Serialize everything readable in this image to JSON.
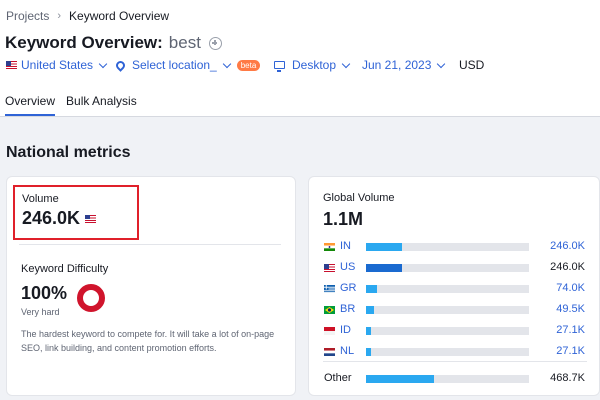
{
  "breadcrumb": {
    "root": "Projects",
    "current": "Keyword Overview"
  },
  "header": {
    "title": "Keyword Overview:",
    "keyword": "best"
  },
  "filters": {
    "country": "United States",
    "location": "Select location_",
    "location_badge": "beta",
    "device": "Desktop",
    "date": "Jun 21, 2023",
    "currency": "USD"
  },
  "tabs": [
    {
      "label": "Overview"
    },
    {
      "label": "Bulk Analysis"
    }
  ],
  "section_title": "National metrics",
  "volume": {
    "label": "Volume",
    "value": "246.0K"
  },
  "keyword_difficulty": {
    "label": "Keyword Difficulty",
    "value": "100%",
    "level": "Very hard",
    "percent": 100,
    "description": "The hardest keyword to compete for. It will take a lot of on-page SEO, link building, and content promotion efforts."
  },
  "global_volume": {
    "label": "Global Volume",
    "value": "1.1M",
    "rows": [
      {
        "code": "IN",
        "value": "246.0K",
        "share": 0.22,
        "color": "#2aa8f0",
        "icon": "india-flag-icon"
      },
      {
        "code": "US",
        "value": "246.0K",
        "share": 0.22,
        "color": "#1a6ad0",
        "icon": "usa-flag-icon"
      },
      {
        "code": "GR",
        "value": "74.0K",
        "share": 0.07,
        "color": "#2aa8f0",
        "icon": "greece-flag-icon"
      },
      {
        "code": "BR",
        "value": "49.5K",
        "share": 0.05,
        "color": "#2aa8f0",
        "icon": "brazil-flag-icon"
      },
      {
        "code": "ID",
        "value": "27.1K",
        "share": 0.03,
        "color": "#2aa8f0",
        "icon": "indonesia-flag-icon"
      },
      {
        "code": "NL",
        "value": "27.1K",
        "share": 0.03,
        "color": "#2aa8f0",
        "icon": "netherlands-flag-icon"
      }
    ],
    "other": {
      "label": "Other",
      "value": "468.7K",
      "share": 0.42,
      "color": "#2aa8f0"
    }
  },
  "colors": {
    "accent": "#2f63d6",
    "highlight_border": "#e0202a",
    "difficulty": "#d0142c",
    "badge": "#ff7a45"
  }
}
